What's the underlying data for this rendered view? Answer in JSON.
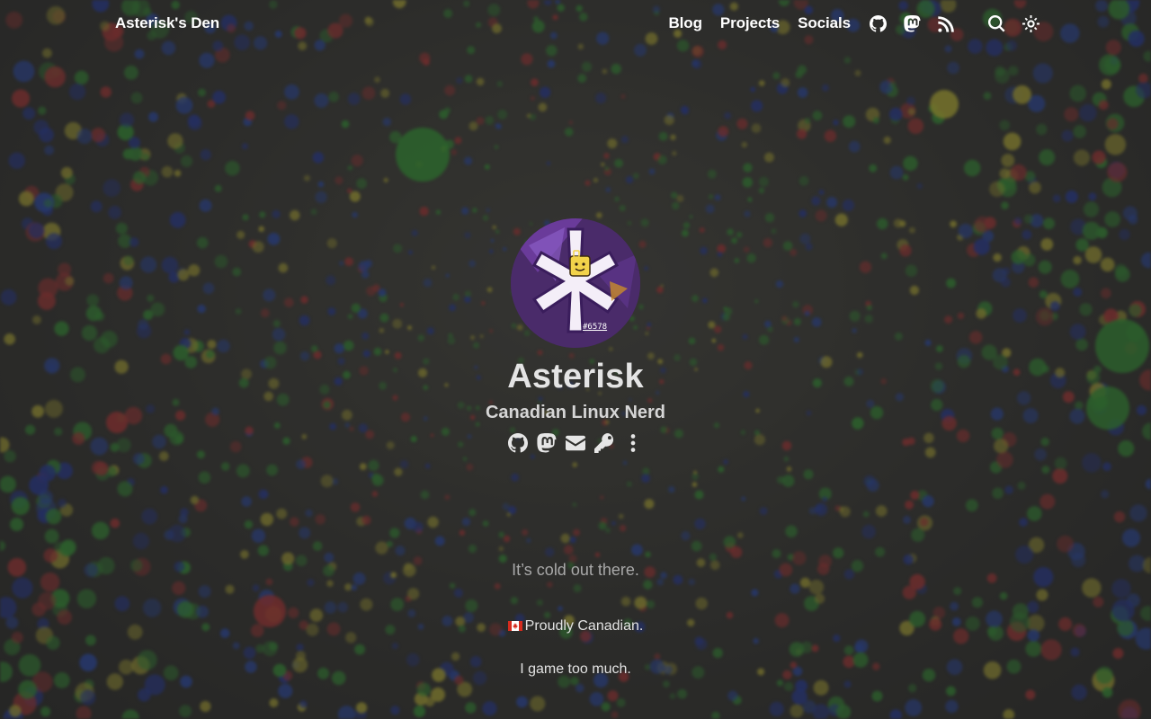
{
  "site": {
    "brand": "Asterisk's Den"
  },
  "nav": {
    "links": [
      "Blog",
      "Projects",
      "Socials"
    ],
    "icons": [
      "github-icon",
      "mastodon-icon",
      "rss-icon",
      "search-icon",
      "theme-toggle-icon"
    ]
  },
  "profile": {
    "avatar_tag": "#6578",
    "name": "Asterisk",
    "subtitle": "Canadian Linux Nerd",
    "social_icons": [
      "github-icon",
      "mastodon-icon",
      "envelope-icon",
      "key-icon",
      "more-vertical-icon"
    ]
  },
  "content": {
    "tagline": "It’s cold out there.",
    "line1_flag": "canada-flag-icon",
    "line1_text": "Proudly Canadian.",
    "line2_text": "I game too much."
  },
  "colors": {
    "text_primary": "#ffffff",
    "text_name": "#e4e4e4",
    "text_muted": "#a9a9a9",
    "background_shade": "#3a3a38",
    "avatar_purple": "#4b2a6b"
  }
}
